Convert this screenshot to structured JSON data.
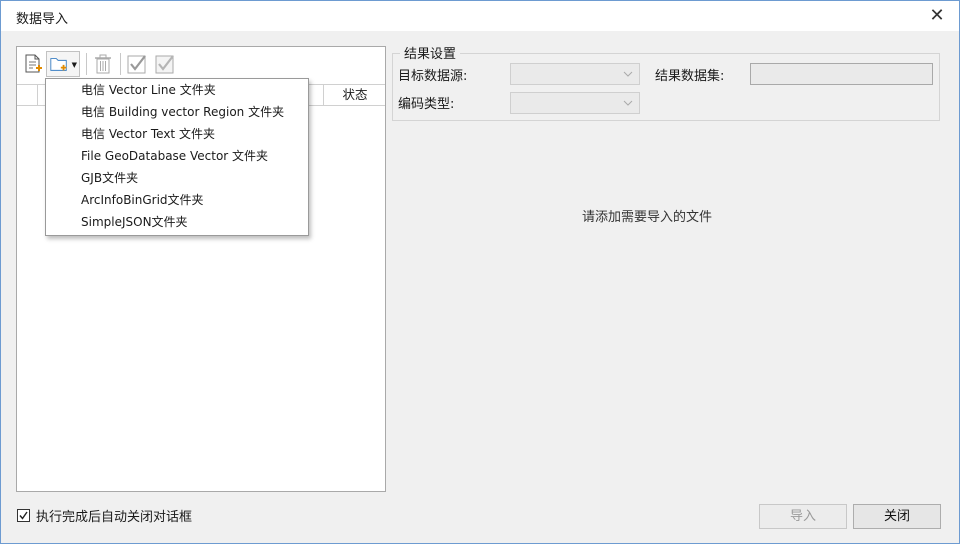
{
  "window": {
    "title": "数据导入"
  },
  "toolbar": {
    "buttons": [
      "add-file-icon",
      "add-folder-icon",
      "delete-icon",
      "select-all-icon",
      "invert-select-icon"
    ]
  },
  "table": {
    "status_header": "状态"
  },
  "folder_menu": {
    "items": [
      "电信 Vector Line 文件夹",
      "电信 Building vector Region 文件夹",
      "电信 Vector Text 文件夹",
      "File GeoDatabase Vector 文件夹",
      "GJB文件夹",
      "ArcInfoBinGrid文件夹",
      "SimpleJSON文件夹"
    ]
  },
  "result_settings": {
    "group_title": "结果设置",
    "target_datasource_label": "目标数据源:",
    "target_dataset_label": "结果数据集:",
    "encoding_label": "编码类型:",
    "target_datasource_value": "",
    "encoding_value": "",
    "target_dataset_value": ""
  },
  "empty_hint": "请添加需要导入的文件",
  "auto_close": {
    "label": "执行完成后自动关闭对话框",
    "checked": true
  },
  "buttons": {
    "import": "导入",
    "close": "关闭"
  },
  "colors": {
    "window_border": "#6d9bd1",
    "background": "#f0f0f0"
  }
}
